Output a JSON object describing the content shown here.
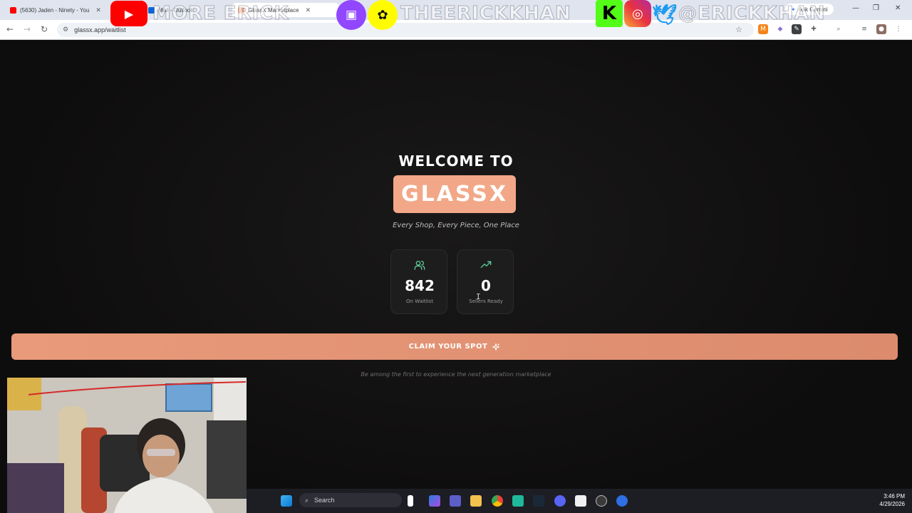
{
  "browser": {
    "tabs": [
      {
        "label": "(5630) Jaden - Ninety - You"
      },
      {
        "label": "Mail - Outlook"
      },
      {
        "label": "GlassX Marketplace"
      }
    ],
    "gemini_label": "Ask Gemini",
    "url": "glassx.app/waitlist",
    "window_controls": [
      "—",
      "❐",
      "✕"
    ]
  },
  "overlay": {
    "text_left": "MORE ERICK",
    "handle_mid": "THEERICKKHAN",
    "handle_right": "@ERICKKHAN",
    "k_letter": "K"
  },
  "hero": {
    "welcome": "WELCOME TO",
    "brand": "GLASSX",
    "tagline": "Every Shop, Every Piece, One Place"
  },
  "stats": [
    {
      "value": "842",
      "label": "On Waitlist",
      "icon": "users-icon"
    },
    {
      "value": "0",
      "label": "Sellers Ready",
      "icon": "trending-up-icon"
    }
  ],
  "cta": {
    "label": "CLAIM YOUR SPOT",
    "icon": "sparkle-icon",
    "subtext": "Be among the first to experience the next generation marketplace"
  },
  "taskbar": {
    "search_placeholder": "Search",
    "time": "3:46 PM",
    "date": "4/29/2026"
  },
  "colors": {
    "accent": "#f2a888",
    "cta": "#e89a7a",
    "icon_green": "#5ed0a0",
    "background": "#0f0e0e"
  }
}
